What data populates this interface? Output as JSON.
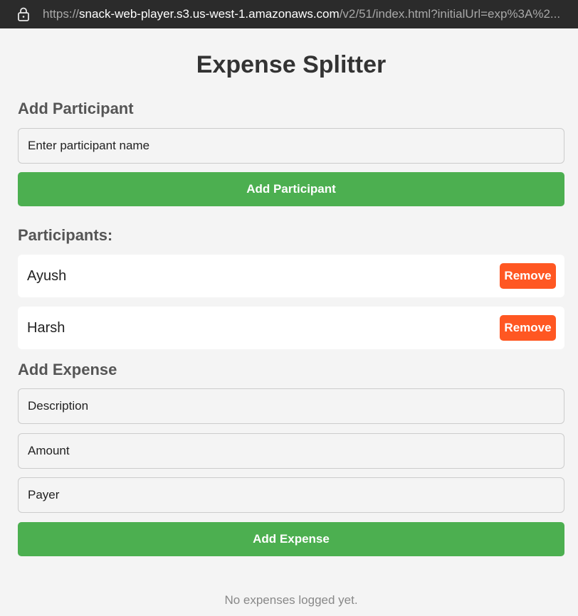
{
  "browser": {
    "url_prefix": "https://",
    "url_host": "snack-web-player.s3.us-west-1.amazonaws.com",
    "url_rest": "/v2/51/index.html?initialUrl=exp%3A%2..."
  },
  "app": {
    "title": "Expense Splitter",
    "add_participant": {
      "heading": "Add Participant",
      "name_placeholder": "Enter participant name",
      "button_label": "Add Participant"
    },
    "participants": {
      "heading": "Participants:",
      "items": [
        {
          "name": "Ayush",
          "remove_label": "Remove"
        },
        {
          "name": "Harsh",
          "remove_label": "Remove"
        }
      ]
    },
    "add_expense": {
      "heading": "Add Expense",
      "description_placeholder": "Description",
      "amount_placeholder": "Amount",
      "payer_placeholder": "Payer",
      "button_label": "Add Expense"
    },
    "expenses": {
      "empty_text": "No expenses logged yet."
    }
  },
  "colors": {
    "primary_green": "#4caf50",
    "remove_orange": "#ff5722",
    "background": "#f4f4f4",
    "address_bar": "#2b2b2b"
  },
  "icons": {
    "address_bar": "lock-icon"
  }
}
